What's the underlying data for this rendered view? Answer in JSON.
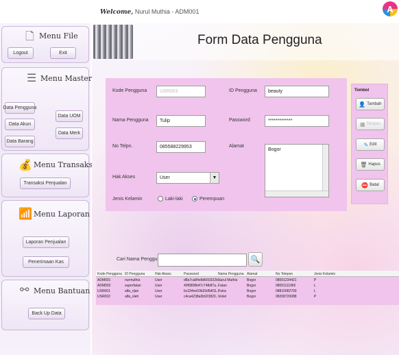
{
  "top": {
    "welcome_label": "Welcome,",
    "welcome_user": "Nurul Muthia - ADM001",
    "badge_letter": "A"
  },
  "sidebar": {
    "file": {
      "title": "Menu File",
      "logout": "Logout",
      "exit": "Exit"
    },
    "master": {
      "title": "Menu Master",
      "pengguna": "Data Pengguna",
      "uom": "Data UOM",
      "akun": "Data Akun",
      "merk": "Data Merk",
      "barang": "Data Barang"
    },
    "transaksi": {
      "title": "Menu Transaksi",
      "penjualan": "Transaksi Penjualan"
    },
    "laporan": {
      "title": "Menu Laporan",
      "penjualan": "Laporan Penjualan",
      "kas": "Penerimaan Kas"
    },
    "bantuan": {
      "title": "Menu Bantuan",
      "backup": "Back Up Data"
    }
  },
  "header": {
    "title": "Form Data Pengguna"
  },
  "form": {
    "kode_label": "Kode Pengguna",
    "kode_value": "USR003",
    "id_label": "ID Pengguna",
    "id_value": "beauty",
    "nama_label": "Nama Pengguna",
    "nama_value": "Tulip",
    "password_label": "Password",
    "password_value": "*************",
    "telp_label": "No Telpn.",
    "telp_value": "085588229953",
    "alamat_label": "Alamat",
    "alamat_value": "Bogor",
    "akses_label": "Hak Akses",
    "akses_value": "User",
    "kelamin_label": "Jenis Kelamin",
    "laki_label": "Laki-laki",
    "perempuan_label": "Perempuan"
  },
  "tombol": {
    "title": "Tombol",
    "tambah": "Tambah",
    "simpan": "Simpan",
    "edit": "Edit",
    "hapus": "Hapus",
    "batal": "Batal"
  },
  "search": {
    "label": "Cari Nama Pengguna"
  },
  "table": {
    "columns": [
      "Kode Pengguna",
      "ID Pengguna",
      "Hak Akses",
      "Password",
      "Nama Pengguna",
      "Alamat",
      "No Telepon",
      "Jenis Kelamin"
    ],
    "rows": [
      [
        "ADM001",
        "nurmuthia",
        "User",
        "d8a7ca84e8d660332b...",
        "Nurul Muthia",
        "Bogor",
        "08001234421",
        "P"
      ],
      [
        "ADM002",
        "superfatan",
        "User",
        "40f5808b47c748df7a...",
        "Fatan",
        "Bogor",
        "08001111966",
        "L"
      ],
      [
        "USR001",
        "alfa_rijan",
        "User",
        "bc334ee03b33d5df11...",
        "Putra",
        "Bogor",
        "08810082700",
        "L"
      ],
      [
        "USR002",
        "alfa_oleh",
        "User",
        "c4ca4238a0b923820...",
        "Violet",
        "Bogor",
        "08208720088",
        "P"
      ]
    ]
  },
  "colors": {
    "panel_pink": "#f0c4ec",
    "accent_blue": "#2b5fb0"
  }
}
